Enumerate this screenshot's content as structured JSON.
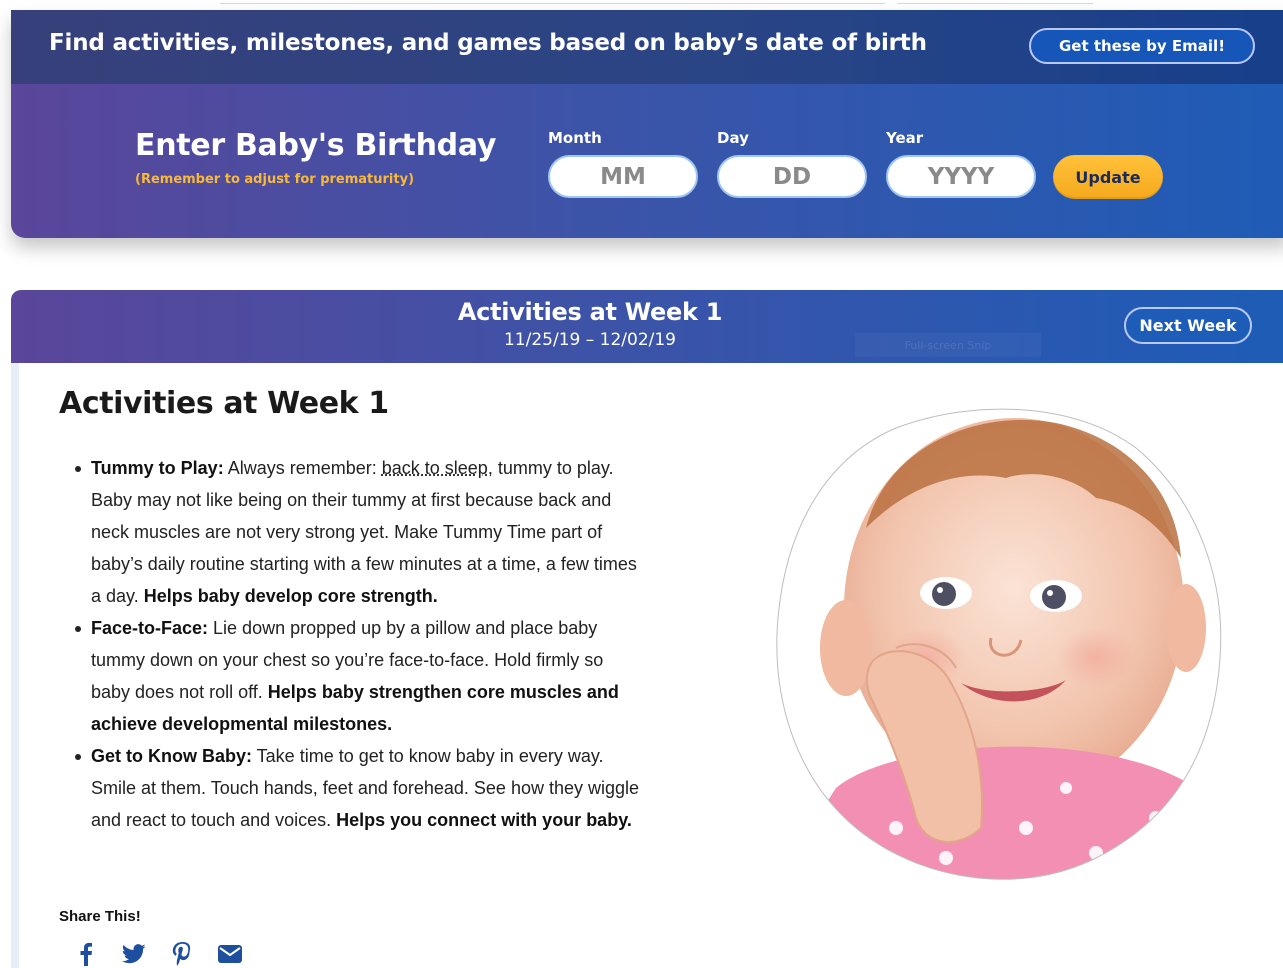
{
  "banner": {
    "headline": "Find activities, milestones, and games based on baby’s date of birth",
    "email_button": "Get these by Email!"
  },
  "birthday_form": {
    "title": "Enter Baby's Birthday",
    "subtitle": "(Remember to adjust for prematurity)",
    "month_label": "Month",
    "day_label": "Day",
    "year_label": "Year",
    "month_placeholder": "MM",
    "day_placeholder": "DD",
    "year_placeholder": "YYYY",
    "update_button": "Update"
  },
  "week_header": {
    "title": "Activities at Week 1",
    "dates": "11/25/19 – 12/02/19",
    "next_button": "Next Week",
    "overlay_hint": "Full-screen Snip"
  },
  "content": {
    "title": "Activities at Week 1",
    "activities": [
      {
        "name": "Tummy to Play:",
        "text_before_link": " Always remember: ",
        "link": "back to sleep",
        "text": ", tummy to play. Baby may not like being on their tummy at first because back and neck muscles are not very strong yet. Make Tummy Time part of baby’s daily routine starting with a few minutes at a time, a few times a day. ",
        "benefit": "Helps baby develop core strength."
      },
      {
        "name": "Face-to-Face:",
        "text": " Lie down propped up by a pillow and place baby tummy down on your chest so you’re face-to-face. Hold firmly so baby does not roll off. ",
        "benefit": "Helps baby strengthen core muscles and achieve developmental milestones."
      },
      {
        "name": "Get to Know Baby:",
        "text": " Take time to get to know baby in every way. Smile at them. Touch hands, feet and forehead. See how they wiggle and react to touch and voices. ",
        "benefit": "Helps you connect with your baby."
      }
    ],
    "share_label": "Share This!",
    "share_icons": [
      "facebook-icon",
      "twitter-icon",
      "pinterest-icon",
      "email-icon"
    ]
  },
  "colors": {
    "panel_gradient_start": "#5a469a",
    "panel_gradient_end": "#1d5cb7",
    "accent_yellow": "#f6a91d",
    "subtitle_yellow": "#f8b93a",
    "share_icon_blue": "#1d4f9e"
  }
}
